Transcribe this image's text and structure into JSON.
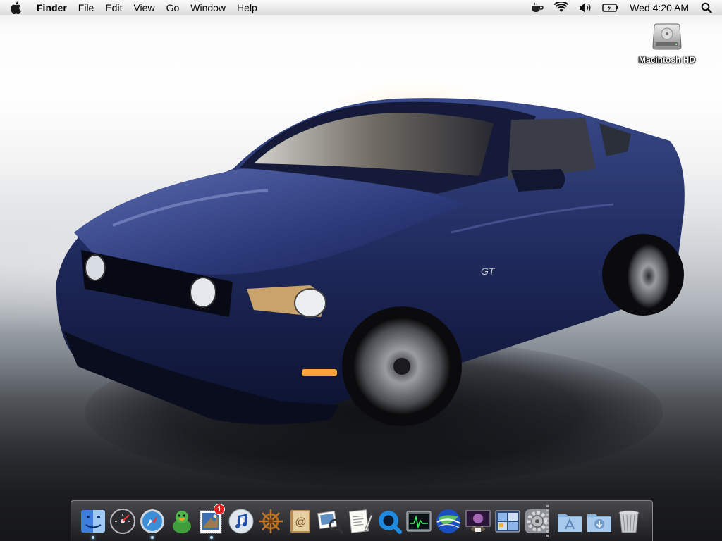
{
  "menubar": {
    "app_name": "Finder",
    "menus": [
      "File",
      "Edit",
      "View",
      "Go",
      "Window",
      "Help"
    ],
    "status_icons": [
      "coffee-cup-icon",
      "wifi-icon",
      "volume-icon",
      "battery-icon"
    ],
    "clock": "Wed 4:20 AM"
  },
  "desktop": {
    "icons": [
      {
        "label": "Macintosh HD",
        "icon": "hard-drive-icon"
      }
    ]
  },
  "dock": {
    "items": [
      {
        "name": "Finder",
        "icon": "finder-icon",
        "running": true
      },
      {
        "name": "Dashboard",
        "icon": "dashboard-icon",
        "running": false
      },
      {
        "name": "Safari",
        "icon": "safari-icon",
        "running": true
      },
      {
        "name": "Adium",
        "icon": "adium-duck-icon",
        "running": false
      },
      {
        "name": "Mail",
        "icon": "mail-stamp-icon",
        "running": true,
        "badge": "1"
      },
      {
        "name": "iTunes",
        "icon": "itunes-icon",
        "running": false
      },
      {
        "name": "Helm",
        "icon": "ship-wheel-icon",
        "running": false
      },
      {
        "name": "Address Book",
        "icon": "address-book-icon",
        "running": false
      },
      {
        "name": "Preview",
        "icon": "preview-icon",
        "running": false
      },
      {
        "name": "TextEdit",
        "icon": "textedit-icon",
        "running": false
      },
      {
        "name": "QuickTime Player",
        "icon": "quicktime-icon",
        "running": false
      },
      {
        "name": "Activity Monitor",
        "icon": "activity-monitor-icon",
        "running": false
      },
      {
        "name": "Google Earth",
        "icon": "google-earth-icon",
        "running": false
      },
      {
        "name": "Front Row",
        "icon": "front-row-icon",
        "running": false
      },
      {
        "name": "Spaces",
        "icon": "spaces-icon",
        "running": false
      },
      {
        "name": "System Preferences",
        "icon": "system-preferences-icon",
        "running": false
      },
      {
        "name": "Applications",
        "icon": "applications-folder-icon",
        "running": false
      },
      {
        "name": "Downloads",
        "icon": "downloads-folder-icon",
        "running": false
      },
      {
        "name": "Trash",
        "icon": "trash-icon",
        "running": false
      }
    ]
  }
}
